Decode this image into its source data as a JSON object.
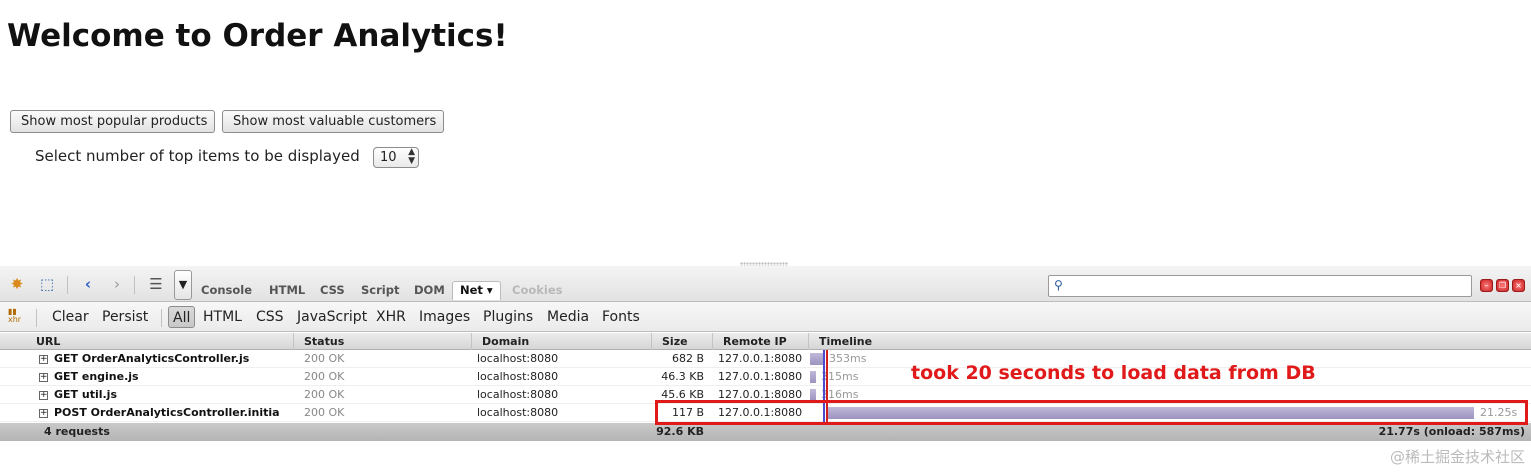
{
  "page": {
    "title": "Welcome to Order Analytics!",
    "buttons": {
      "popular": "Show most popular products",
      "valuable": "Show most valuable customers"
    },
    "select_label": "Select number of top items to be displayed",
    "select_value": "10"
  },
  "firebug": {
    "panel_tabs": [
      "Console",
      "HTML",
      "CSS",
      "Script",
      "DOM",
      "Net ▾",
      "Cookies"
    ],
    "active_panel": "Net",
    "search_placeholder": "",
    "net_actions": {
      "clear": "Clear",
      "persist": "Persist"
    },
    "filters": [
      "All",
      "HTML",
      "CSS",
      "JavaScript",
      "XHR",
      "Images",
      "Plugins",
      "Media",
      "Fonts"
    ],
    "active_filter": "All",
    "columns": {
      "url": "URL",
      "status": "Status",
      "domain": "Domain",
      "size": "Size",
      "remote_ip": "Remote IP",
      "timeline": "Timeline"
    },
    "requests": [
      {
        "url": "GET OrderAnalyticsController.js",
        "status": "200 OK",
        "domain": "localhost:8080",
        "size": "682 B",
        "remote_ip": "127.0.0.1:8080",
        "timing": "353ms"
      },
      {
        "url": "GET engine.js",
        "status": "200 OK",
        "domain": "localhost:8080",
        "size": "46.3 KB",
        "remote_ip": "127.0.0.1:8080",
        "timing": "315ms"
      },
      {
        "url": "GET util.js",
        "status": "200 OK",
        "domain": "localhost:8080",
        "size": "45.6 KB",
        "remote_ip": "127.0.0.1:8080",
        "timing": "316ms"
      },
      {
        "url": "POST OrderAnalyticsController.initia",
        "status": "200 OK",
        "domain": "localhost:8080",
        "size": "117 B",
        "remote_ip": "127.0.0.1:8080",
        "timing": "21.25s"
      }
    ],
    "summary": {
      "count": "4 requests",
      "total_size": "92.6 KB",
      "total_time": "21.77s (onload: 587ms)"
    },
    "icons": [
      "firebug-icon",
      "inspect-icon",
      "back-icon",
      "forward-icon",
      "list-icon",
      "menu-dropdown-icon",
      "search-icon",
      "xhr-icon"
    ]
  },
  "annotation": {
    "text": "took 20 seconds to load data from DB",
    "color": "#e01a1a"
  },
  "watermark": "@稀土掘金技术社区",
  "colors": {
    "timeline_bar": "#a79ec8",
    "domcontent_marker": "#4a4ad0",
    "load_marker": "#d02020"
  }
}
